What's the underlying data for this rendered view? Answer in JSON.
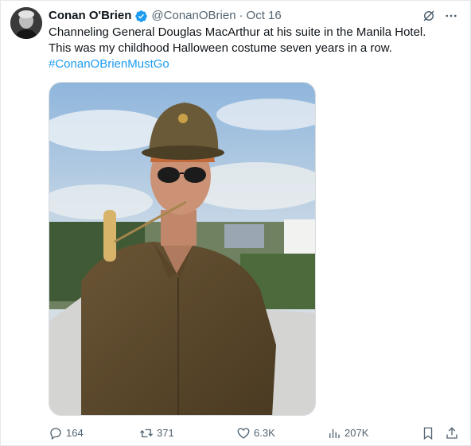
{
  "tweet": {
    "author_name": "Conan O'Brien",
    "handle": "@ConanOBrien",
    "separator": "·",
    "date": "Oct 16",
    "text_line1": "Channeling General Douglas MacArthur at his suite in the Manila Hotel.",
    "text_line2": "This was my childhood Halloween costume seven years in a row.",
    "hashtag": "#ConanOBrienMustGo"
  },
  "actions": {
    "replies": "164",
    "reposts": "371",
    "likes": "6.3K",
    "views": "207K"
  },
  "icons": {
    "verified": "verified-badge-icon",
    "grok": "grok-icon",
    "more": "more-icon",
    "reply": "reply-icon",
    "repost": "repost-icon",
    "like": "heart-icon",
    "views": "views-chart-icon",
    "bookmark": "bookmark-icon",
    "share": "share-icon"
  },
  "colors": {
    "accent": "#1d9bf0",
    "secondary_text": "#536471",
    "primary_text": "#0f1419"
  }
}
